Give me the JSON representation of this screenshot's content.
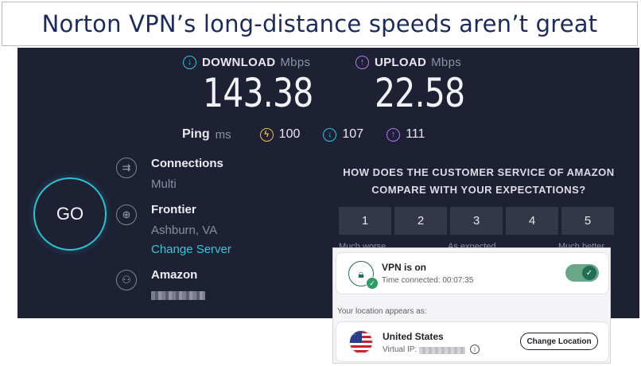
{
  "banner": {
    "title": "Norton VPN’s long-distance speeds aren’t great"
  },
  "speedtest": {
    "download": {
      "label": "DOWNLOAD",
      "unit": "Mbps",
      "value": "143.38"
    },
    "upload": {
      "label": "UPLOAD",
      "unit": "Mbps",
      "value": "22.58"
    },
    "ping": {
      "label": "Ping",
      "unit": "ms",
      "idle": "100",
      "download": "107",
      "upload": "111"
    },
    "go_label": "GO",
    "connections": {
      "title": "Connections",
      "value": "Multi"
    },
    "isp": {
      "title": "Frontier",
      "location": "Ashburn, VA",
      "change_link": "Change Server"
    },
    "host": {
      "title": "Amazon"
    },
    "survey": {
      "question": "HOW DOES THE CUSTOMER SERVICE OF AMAZON COMPARE WITH YOUR EXPECTATIONS?",
      "options": [
        "1",
        "2",
        "3",
        "4",
        "5"
      ],
      "scale_labels": {
        "low": "Much worse",
        "mid": "As expected",
        "high": "Much better"
      }
    },
    "colors": {
      "background": "#1e2034",
      "accent": "#2cc2d2",
      "upload_accent": "#b27ae8",
      "ping_accent": "#f0c040"
    }
  },
  "norton": {
    "status_title": "VPN is on",
    "time_connected": "Time connected: 00:07:35",
    "toggle_on": true,
    "location_label": "Your location appears as:",
    "country": "United States",
    "virtual_ip_label": "Virtual IP:",
    "change_location": "Change Location",
    "colors": {
      "toggle": "#1f6f54",
      "card": "#f4f4f6"
    }
  }
}
